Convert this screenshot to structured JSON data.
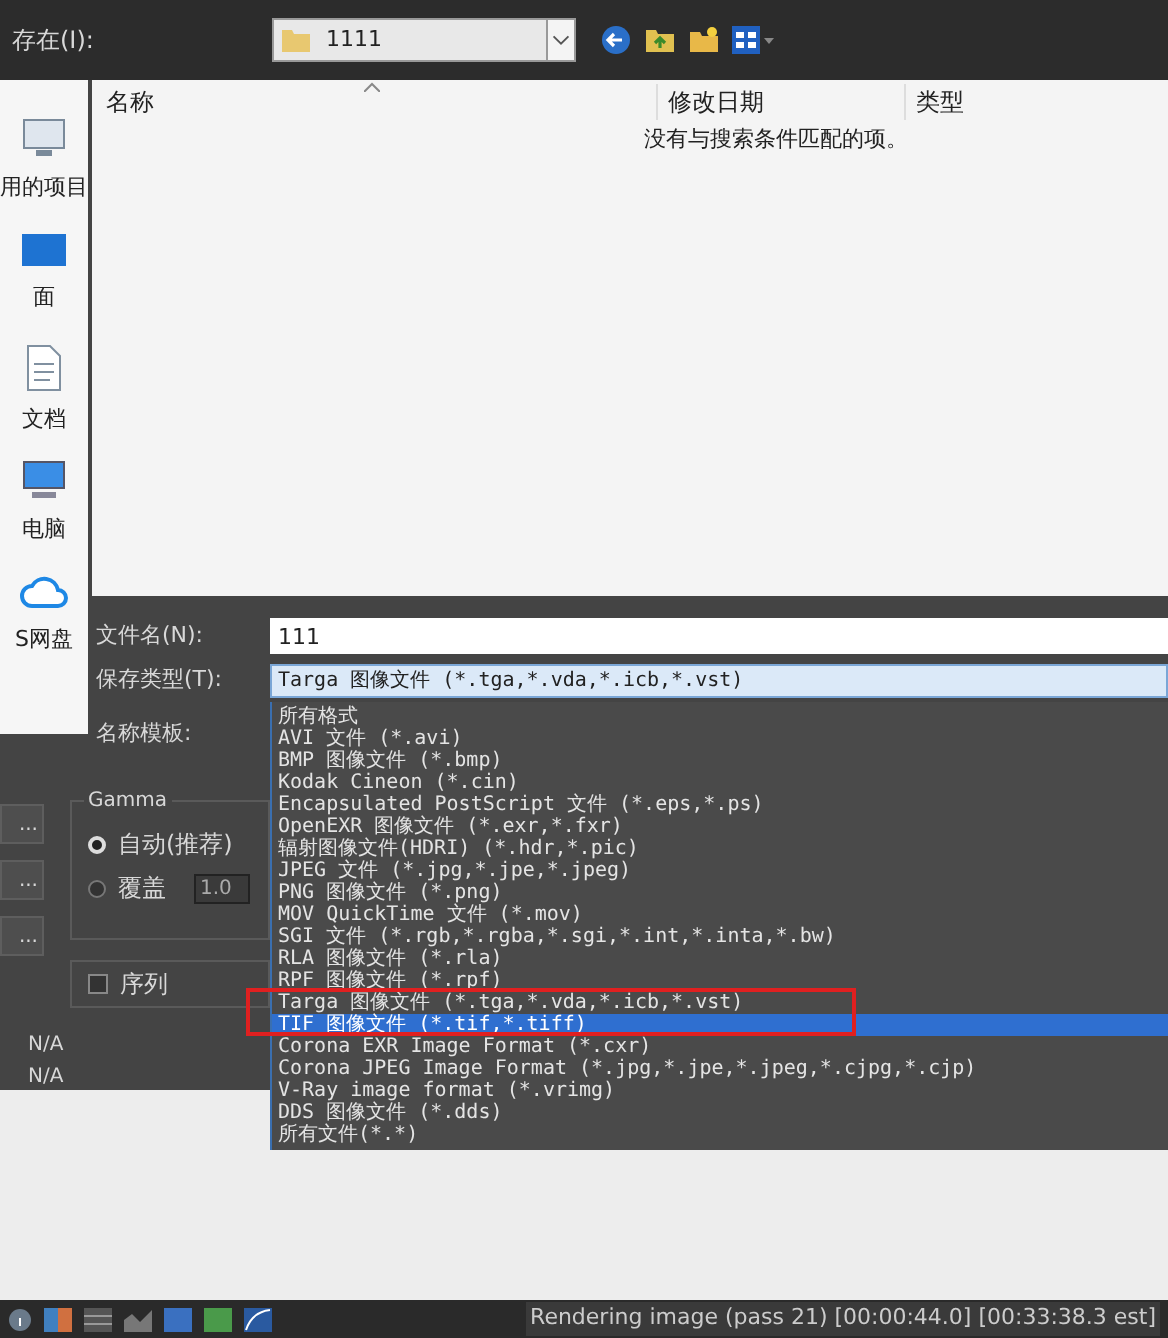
{
  "save_in": {
    "label": "存在(I):",
    "value": "1111"
  },
  "sidebar": {
    "items": [
      {
        "label": "用的项目",
        "kind": "recent"
      },
      {
        "label": "面",
        "kind": "desktop"
      },
      {
        "label": "文档",
        "kind": "documents"
      },
      {
        "label": "电脑",
        "kind": "computer"
      },
      {
        "label": "S网盘",
        "kind": "cloud"
      }
    ]
  },
  "file_list": {
    "columns": [
      "名称",
      "修改日期",
      "类型"
    ],
    "empty_message": "没有与搜索条件匹配的项。"
  },
  "form": {
    "file_name": {
      "label": "文件名(N):",
      "value": "111"
    },
    "save_type": {
      "label": "保存类型(T):",
      "value": "Targa 图像文件 (*.tga,*.vda,*.icb,*.vst)"
    },
    "name_template": {
      "label": "名称模板:"
    }
  },
  "type_options": [
    {
      "label": "所有格式",
      "selected": false
    },
    {
      "label": "AVI 文件 (*.avi)",
      "selected": false
    },
    {
      "label": "BMP 图像文件 (*.bmp)",
      "selected": false
    },
    {
      "label": "Kodak Cineon (*.cin)",
      "selected": false
    },
    {
      "label": "Encapsulated PostScript 文件 (*.eps,*.ps)",
      "selected": false
    },
    {
      "label": "OpenEXR 图像文件 (*.exr,*.fxr)",
      "selected": false
    },
    {
      "label": "辐射图像文件(HDRI) (*.hdr,*.pic)",
      "selected": false
    },
    {
      "label": "JPEG 文件 (*.jpg,*.jpe,*.jpeg)",
      "selected": false
    },
    {
      "label": "PNG 图像文件 (*.png)",
      "selected": false
    },
    {
      "label": "MOV QuickTime 文件 (*.mov)",
      "selected": false
    },
    {
      "label": "SGI 文件 (*.rgb,*.rgba,*.sgi,*.int,*.inta,*.bw)",
      "selected": false
    },
    {
      "label": "RLA 图像文件 (*.rla)",
      "selected": false
    },
    {
      "label": "RPF 图像文件 (*.rpf)",
      "selected": false
    },
    {
      "label": "Targa 图像文件 (*.tga,*.vda,*.icb,*.vst)",
      "selected": false
    },
    {
      "label": "TIF 图像文件 (*.tif,*.tiff)",
      "selected": true
    },
    {
      "label": "Corona EXR Image Format (*.cxr)",
      "selected": false
    },
    {
      "label": "Corona JPEG Image Format (*.jpg,*.jpe,*.jpeg,*.cjpg,*.cjp)",
      "selected": false
    },
    {
      "label": "V-Ray image format (*.vrimg)",
      "selected": false
    },
    {
      "label": "DDS 图像文件 (*.dds)",
      "selected": false
    },
    {
      "label": "所有文件(*.*)",
      "selected": false
    }
  ],
  "side_buttons": [
    "...",
    "...",
    "..."
  ],
  "gamma": {
    "title": "Gamma",
    "options": [
      {
        "label": "自动(推荐)",
        "selected": true
      },
      {
        "label": "覆盖",
        "selected": false
      }
    ],
    "override_value": "1.0"
  },
  "sequence": {
    "label": "序列",
    "checked": false
  },
  "info_values": [
    "N/A",
    "N/A"
  ],
  "status_bar": {
    "text": "Rendering image (pass 21) [00:00:44.0] [00:33:38.3 est]"
  }
}
